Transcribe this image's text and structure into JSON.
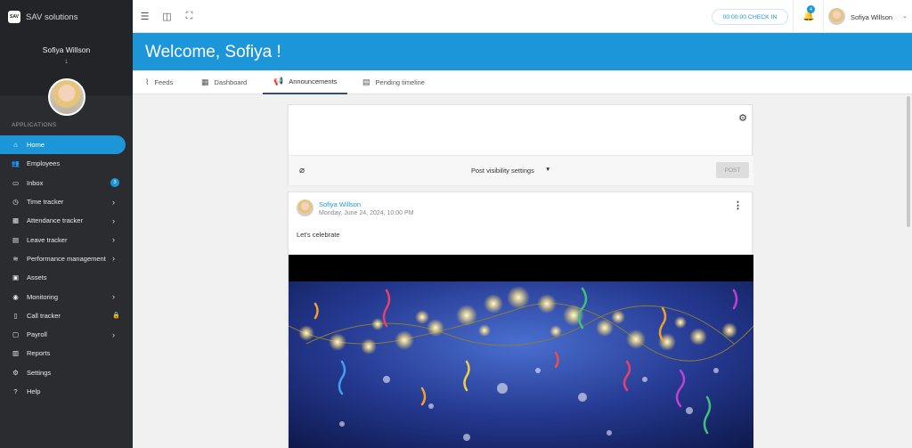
{
  "brand": {
    "logo_text": "SAV",
    "name": "SAV solutions"
  },
  "sidebar": {
    "user_name": "Sofiya Willson",
    "user_sub": "1",
    "section_label": "APPLICATIONS",
    "items": [
      {
        "label": "Home",
        "icon": "home-icon"
      },
      {
        "label": "Employees",
        "icon": "users-icon"
      },
      {
        "label": "Inbox",
        "icon": "inbox-icon",
        "badge": "3"
      },
      {
        "label": "Time tracker",
        "icon": "clock-icon"
      },
      {
        "label": "Attendance tracker",
        "icon": "calendar-icon"
      },
      {
        "label": "Leave tracker",
        "icon": "calendar-leave-icon"
      },
      {
        "label": "Performance management",
        "icon": "wifi-icon"
      },
      {
        "label": "Assets",
        "icon": "box-icon"
      },
      {
        "label": "Monitoring",
        "icon": "eye-icon"
      },
      {
        "label": "Call tracker",
        "icon": "phone-icon"
      },
      {
        "label": "Payroll",
        "icon": "wallet-icon"
      },
      {
        "label": "Reports",
        "icon": "report-icon"
      },
      {
        "label": "Settings",
        "icon": "gear-icon"
      },
      {
        "label": "Help",
        "icon": "help-icon"
      }
    ]
  },
  "topbar": {
    "checkin_label": "00:00:00 CHECK IN",
    "notification_count": "4",
    "user_name": "Sofiya Willson"
  },
  "banner": {
    "welcome": "Welcome, Sofiya !"
  },
  "tabs": [
    {
      "label": "Feeds"
    },
    {
      "label": "Dashboard"
    },
    {
      "label": "Announcements"
    },
    {
      "label": "Pending timeline"
    }
  ],
  "composer": {
    "visibility_label": "Post visibility settings",
    "post_label": "POST"
  },
  "post": {
    "author": "Sofiya Willson",
    "date": "Monday, June 24, 2024, 10:00 PM",
    "text": "Let's celebrate"
  },
  "colors": {
    "accent": "#1c96d9",
    "sidebar": "#2b2c30",
    "sidebar_top": "#232428"
  }
}
